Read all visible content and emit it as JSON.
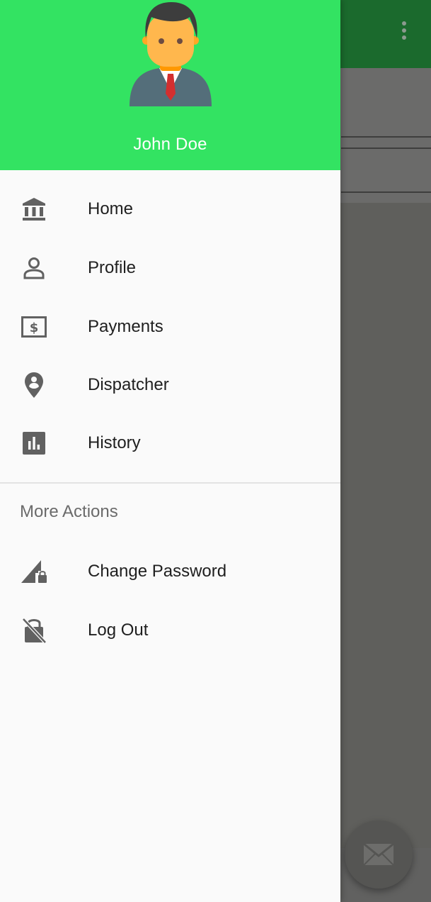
{
  "header": {
    "user_name": "John Doe"
  },
  "menu": {
    "items": [
      {
        "label": "Home",
        "icon": "bank-icon"
      },
      {
        "label": "Profile",
        "icon": "person-icon"
      },
      {
        "label": "Payments",
        "icon": "payments-icon"
      },
      {
        "label": "Dispatcher",
        "icon": "location-pin-icon"
      },
      {
        "label": "History",
        "icon": "bar-chart-icon"
      }
    ]
  },
  "more_actions": {
    "title": "More Actions",
    "items": [
      {
        "label": "Change Password",
        "icon": "signal-lock-icon"
      },
      {
        "label": "Log Out",
        "icon": "lock-off-icon"
      }
    ]
  },
  "colors": {
    "header_bg": "#33e362",
    "toolbar_bg": "#1b6a2d",
    "drawer_bg": "#fafafa",
    "icon": "#616161",
    "text": "#1f1f1f"
  }
}
